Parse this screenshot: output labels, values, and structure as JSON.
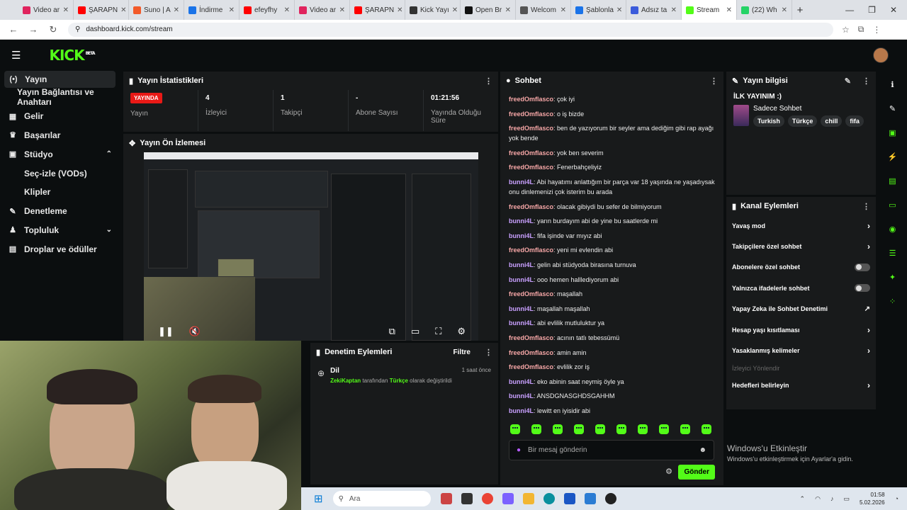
{
  "browser": {
    "tabs": [
      {
        "label": "Video ar",
        "color": "#e0245e"
      },
      {
        "label": "ŞARAPN",
        "color": "#ff0000"
      },
      {
        "label": "Suno | A",
        "color": "#f25a2a"
      },
      {
        "label": "İndirme",
        "color": "#1a73e8"
      },
      {
        "label": "efeyfhy",
        "color": "#ff0000"
      },
      {
        "label": "Video ar",
        "color": "#e0245e"
      },
      {
        "label": "ŞARAPN",
        "color": "#ff0000"
      },
      {
        "label": "Kick Yayı",
        "color": "#333333"
      },
      {
        "label": "Open Br",
        "color": "#111111"
      },
      {
        "label": "Welcom",
        "color": "#555555"
      },
      {
        "label": "Şablonla",
        "color": "#1a73e8"
      },
      {
        "label": "Adsız ta",
        "color": "#3b5bdb"
      },
      {
        "label": "Stream",
        "color": "#53fc18"
      },
      {
        "label": "(22) Wh",
        "color": "#25d366"
      }
    ],
    "active_tab": 12,
    "url": "dashboard.kick.com/stream"
  },
  "app": {
    "logo": "KICK",
    "logo_badge": "BETA"
  },
  "sidebar": {
    "items": [
      {
        "label": "Yayın",
        "icon": "broadcast-icon",
        "active": true
      },
      {
        "label": "Yayın Bağlantısı ve Anahtarı",
        "sub": true
      },
      {
        "label": "Gelir",
        "icon": "chart-icon"
      },
      {
        "label": "Başarılar",
        "icon": "trophy-icon"
      },
      {
        "label": "Stüdyo",
        "icon": "video-icon",
        "chevron": "up"
      },
      {
        "label": "Seç-izle (VODs)",
        "sub2": true
      },
      {
        "label": "Klipler",
        "sub2": true
      },
      {
        "label": "Denetleme",
        "icon": "wrench-icon"
      },
      {
        "label": "Topluluk",
        "icon": "users-icon",
        "chevron": "down"
      },
      {
        "label": "Droplar ve ödüller",
        "icon": "gift-icon"
      }
    ]
  },
  "stats": {
    "title": "Yayın İstatistikleri",
    "live_badge": "YAYINDA",
    "status_label": "Yayın",
    "viewers": "4",
    "viewers_label": "İzleyici",
    "followers": "1",
    "followers_label": "Takipçi",
    "subs": "-",
    "subs_label": "Abone Sayısı",
    "uptime": "01:21:56",
    "uptime_label": "Yayında Olduğu Süre"
  },
  "preview": {
    "title": "Yayın Ön İzlemesi"
  },
  "moderation": {
    "title": "Denetim Eylemleri",
    "filter": "Filtre",
    "event_title": "Dil",
    "event_user": "ZekiKaptan",
    "event_mid": "tarafından",
    "event_value": "Türkçe",
    "event_tail": "olarak değiştirildi",
    "event_time": "1 saat önce"
  },
  "chat": {
    "title": "Sohbet",
    "messages": [
      {
        "user": "freedOmflasco",
        "text": "çok iyi",
        "c": 1
      },
      {
        "user": "freedOmflasco",
        "text": "o iş bizde",
        "c": 1
      },
      {
        "user": "freedOmflasco",
        "text": "ben de yazıyorum bir seyler ama dediğim gibi rap ayağı yok bende",
        "c": 1
      },
      {
        "user": "freedOmflasco",
        "text": "yok ben severim",
        "c": 1
      },
      {
        "user": "freedOmflasco",
        "text": "Fenerbahçeliyiz",
        "c": 1
      },
      {
        "user": "bunni4L",
        "text": "Abi hayatımı anlattığım bir parça var 18 yaşında ne yaşadıysak onu dinlemenizi çok isterim bu arada",
        "c": 2
      },
      {
        "user": "freedOmflasco",
        "text": "olacak gibiydi bu sefer de bilmiyorum",
        "c": 1
      },
      {
        "user": "bunni4L",
        "text": "yarın burdayım abi de yine bu saatlerde mi",
        "c": 2
      },
      {
        "user": "bunni4L",
        "text": "fifa işinde var mıyız abi",
        "c": 2
      },
      {
        "user": "freedOmflasco",
        "text": "yeni mi evlendin abi",
        "c": 1
      },
      {
        "user": "bunni4L",
        "text": "gelin abi stüdyoda birasına turnuva",
        "c": 2
      },
      {
        "user": "bunni4L",
        "text": "ooo hemen halllediyorum abi",
        "c": 2
      },
      {
        "user": "freedOmflasco",
        "text": "maşallah",
        "c": 1
      },
      {
        "user": "bunni4L",
        "text": "maşallah maşallah",
        "c": 2
      },
      {
        "user": "bunni4L",
        "text": "abi evlilik mutluluktur ya",
        "c": 2
      },
      {
        "user": "freedOmflasco",
        "text": "acının tatlı tebessümü",
        "c": 1
      },
      {
        "user": "freedOmflasco",
        "text": "amin amin",
        "c": 1
      },
      {
        "user": "freedOmflasco",
        "text": "evlilik zor iş",
        "c": 1
      },
      {
        "user": "bunni4L",
        "text": "eko abinin saat neymiş öyle ya",
        "c": 2
      },
      {
        "user": "bunni4L",
        "text": "ANSDGNASGHDSGAHHM",
        "c": 2
      },
      {
        "user": "bunni4L",
        "text": "lewitt en iyisidir abi",
        "c": 2
      }
    ],
    "placeholder": "Bir mesaj gönderin",
    "send": "Gönder"
  },
  "stream_info": {
    "title": "Yayın bilgisi",
    "stream_title": "İLK YAYINIM :)",
    "category": "Sadece Sohbet",
    "tags": [
      "Turkish",
      "Türkçe",
      "chill",
      "fifa"
    ]
  },
  "channel_actions": {
    "title": "Kanal Eylemleri",
    "items": [
      {
        "label": "Yavaş mod",
        "kind": "arrow"
      },
      {
        "label": "Takipçilere özel sohbet",
        "kind": "arrow"
      },
      {
        "label": "Abonelere özel sohbet",
        "kind": "toggle"
      },
      {
        "label": "Yalnızca ifadelerle sohbet",
        "kind": "toggle"
      },
      {
        "label": "Yapay Zeka ile Sohbet Denetimi",
        "kind": "external"
      },
      {
        "label": "Hesap yaşı kısıtlaması",
        "kind": "arrow"
      },
      {
        "label": "Yasaklanmış kelimeler",
        "kind": "arrow"
      },
      {
        "label": "İzleyici Yönlendir",
        "kind": "dim"
      },
      {
        "label": "Hedefleri belirleyin",
        "kind": "arrow"
      }
    ]
  },
  "watermark": {
    "line1": "Windows'u Etkinleştir",
    "line2": "Windows'u etkinleştirmek için Ayarlar'a gidin."
  },
  "taskbar": {
    "search": "Ara",
    "time": "01:58",
    "date": "5.02.2026"
  }
}
